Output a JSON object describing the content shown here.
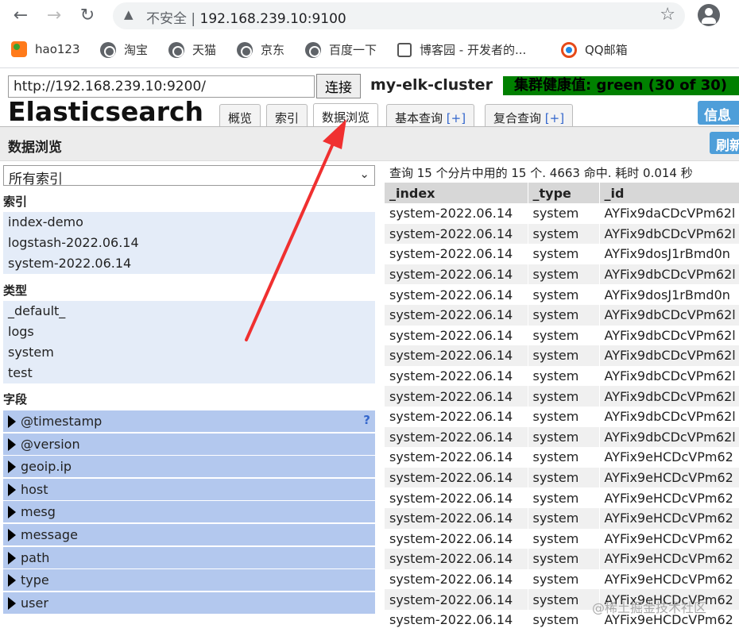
{
  "browser": {
    "back": "←",
    "forward": "→",
    "reload": "↻",
    "security_label": "不安全",
    "separator": "|",
    "url": "192.168.239.10:9100",
    "bookmarks": [
      "hao123",
      "淘宝",
      "天猫",
      "京东",
      "百度一下",
      "博客园 - 开发者的...",
      "QQ邮箱"
    ]
  },
  "header": {
    "cluster_url": "http://192.168.239.10:9200/",
    "connect_label": "连接",
    "cluster_name": "my-elk-cluster",
    "health": "集群健康值: green (30 of 30)",
    "brand": "Elasticsearch",
    "info_label": "信息"
  },
  "tabs": [
    {
      "label": "概览"
    },
    {
      "label": "索引"
    },
    {
      "label": "数据浏览"
    },
    {
      "label": "基本查询",
      "plus": "[+]"
    },
    {
      "label": "复合查询",
      "plus": "[+]"
    }
  ],
  "section": {
    "title": "数据浏览",
    "refresh_label": "刷新"
  },
  "sidebar": {
    "index_select": "所有索引",
    "indices_title": "索引",
    "indices": [
      "index-demo",
      "logstash-2022.06.14",
      "system-2022.06.14"
    ],
    "types_title": "类型",
    "types": [
      "_default_",
      "logs",
      "system",
      "test"
    ],
    "fields_title": "字段",
    "fields": [
      "@timestamp",
      "@version",
      "geoip.ip",
      "host",
      "mesg",
      "message",
      "path",
      "type",
      "user"
    ],
    "help_mark": "?"
  },
  "results": {
    "summary": "查询 15 个分片中用的 15 个. 4663 命中. 耗时 0.014 秒",
    "columns": [
      "_index",
      "_type",
      "_id"
    ],
    "rows": [
      [
        "system-2022.06.14",
        "system",
        "AYFix9daCDcVPm62l"
      ],
      [
        "system-2022.06.14",
        "system",
        "AYFix9dbCDcVPm62l"
      ],
      [
        "system-2022.06.14",
        "system",
        "AYFix9dosJ1rBmd0n"
      ],
      [
        "system-2022.06.14",
        "system",
        "AYFix9dbCDcVPm62l"
      ],
      [
        "system-2022.06.14",
        "system",
        "AYFix9dosJ1rBmd0n"
      ],
      [
        "system-2022.06.14",
        "system",
        "AYFix9dbCDcVPm62l"
      ],
      [
        "system-2022.06.14",
        "system",
        "AYFix9dbCDcVPm62l"
      ],
      [
        "system-2022.06.14",
        "system",
        "AYFix9dbCDcVPm62l"
      ],
      [
        "system-2022.06.14",
        "system",
        "AYFix9dbCDcVPm62l"
      ],
      [
        "system-2022.06.14",
        "system",
        "AYFix9dbCDcVPm62l"
      ],
      [
        "system-2022.06.14",
        "system",
        "AYFix9dbCDcVPm62l"
      ],
      [
        "system-2022.06.14",
        "system",
        "AYFix9dbCDcVPm62l"
      ],
      [
        "system-2022.06.14",
        "system",
        "AYFix9eHCDcVPm62"
      ],
      [
        "system-2022.06.14",
        "system",
        "AYFix9eHCDcVPm62"
      ],
      [
        "system-2022.06.14",
        "system",
        "AYFix9eHCDcVPm62"
      ],
      [
        "system-2022.06.14",
        "system",
        "AYFix9eHCDcVPm62"
      ],
      [
        "system-2022.06.14",
        "system",
        "AYFix9eHCDcVPm62"
      ],
      [
        "system-2022.06.14",
        "system",
        "AYFix9eHCDcVPm62"
      ],
      [
        "system-2022.06.14",
        "system",
        "AYFix9eHCDcVPm62"
      ],
      [
        "system-2022.06.14",
        "system",
        "AYFix9eHCDcVPm62"
      ],
      [
        "system-2022.06.14",
        "system",
        "AYFix9eHCDcVPm62"
      ]
    ]
  },
  "watermark": "@稀土掘金技术社区",
  "colors": {
    "health_bg": "#008000",
    "button_blue": "#4e9ed9",
    "field_bg": "#b3c8ee",
    "group_bg": "#e4ecf8",
    "arrow": "#f03030"
  }
}
